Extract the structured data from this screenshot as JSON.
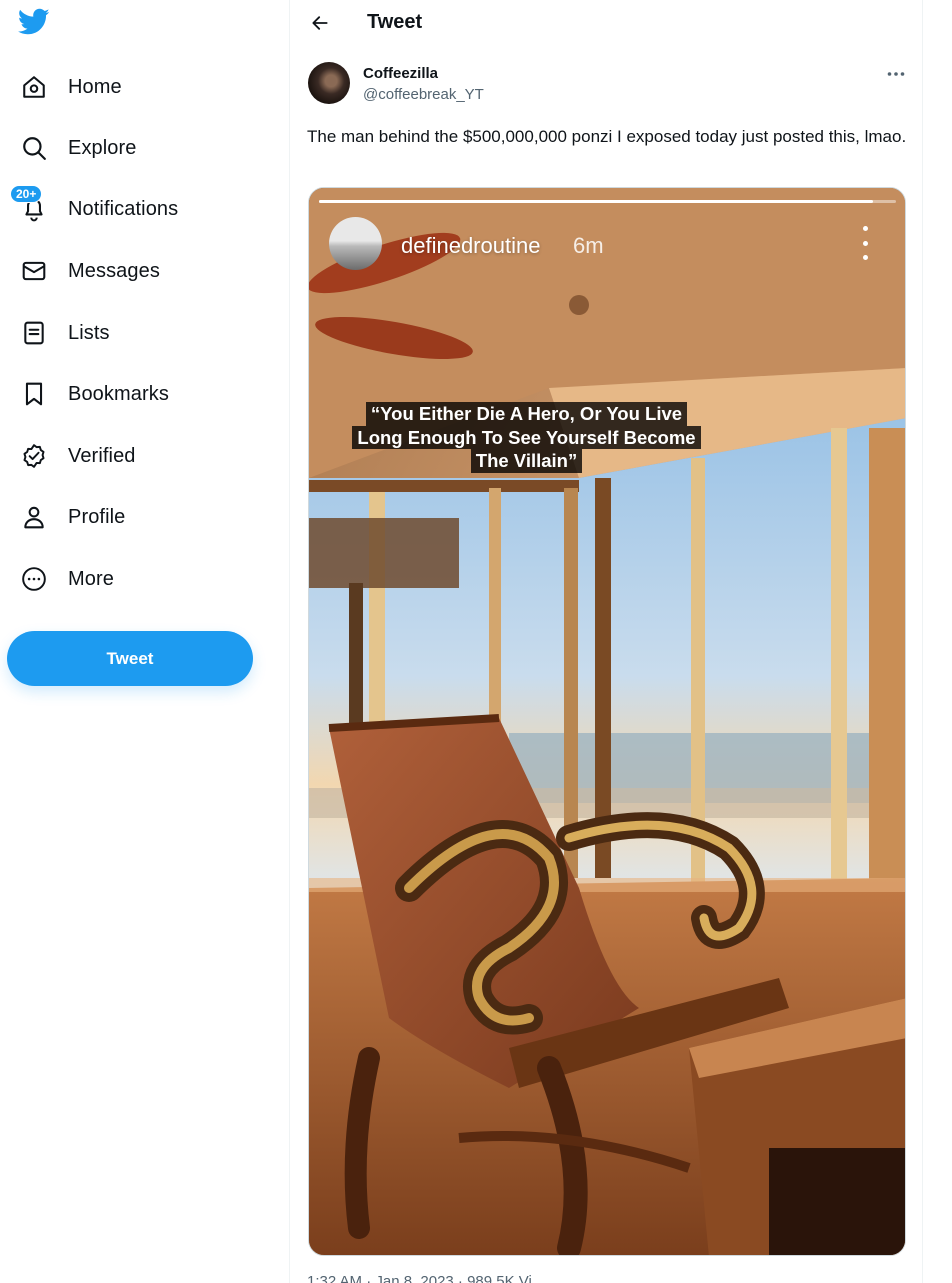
{
  "nav": {
    "items": [
      {
        "label": "Home",
        "icon": "home-icon"
      },
      {
        "label": "Explore",
        "icon": "search-icon"
      },
      {
        "label": "Notifications",
        "icon": "bell-icon"
      },
      {
        "label": "Messages",
        "icon": "mail-icon"
      },
      {
        "label": "Lists",
        "icon": "list-icon"
      },
      {
        "label": "Bookmarks",
        "icon": "bookmark-icon"
      },
      {
        "label": "Verified",
        "icon": "verified-icon"
      },
      {
        "label": "Profile",
        "icon": "person-icon"
      },
      {
        "label": "More",
        "icon": "more-circle-icon"
      }
    ],
    "notifications_badge": "20+",
    "tweet_button": "Tweet"
  },
  "header": {
    "title": "Tweet"
  },
  "tweet": {
    "author_name": "Coffeezilla",
    "author_handle": "@coffeebreak_YT",
    "text": "The man behind the $500,000,000 ponzi I exposed today just posted this, lmao.",
    "timestamp_partial": "1:32 AM · Jan 8, 2023 · 989.5K Vi",
    "media": {
      "story_username": "definedroutine",
      "story_time": "6m",
      "story_progress": 0.96,
      "caption_lines": [
        "“You Either Die A Hero, Or You Live",
        "Long Enough To See Yourself Become",
        "The Villain”"
      ]
    }
  },
  "colors": {
    "accent": "#1d9bf0",
    "text": "#0f1419",
    "secondary_text": "#536471",
    "border": "#eff3f4"
  }
}
